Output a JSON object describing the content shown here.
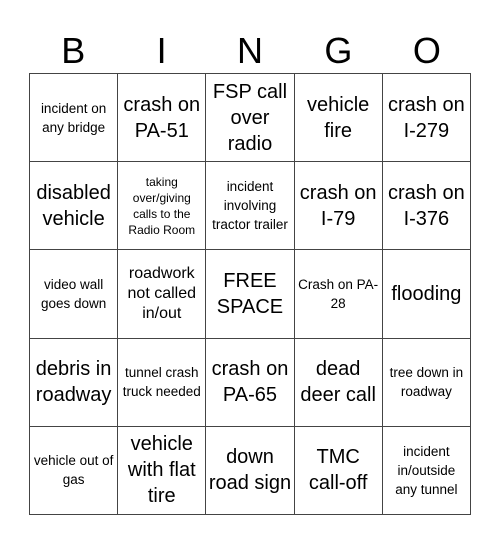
{
  "header": {
    "letters": [
      "B",
      "I",
      "N",
      "G",
      "O"
    ]
  },
  "card": {
    "rows": [
      [
        "incident on any bridge",
        "crash on PA-51",
        "FSP call over radio",
        "vehicle fire",
        "crash on I-279"
      ],
      [
        "disabled vehicle",
        "taking over/giving calls to the Radio Room",
        "incident involving tractor trailer",
        "crash on I-79",
        "crash on I-376"
      ],
      [
        "video wall goes down",
        "roadwork not called in/out",
        "FREE SPACE",
        "Crash on PA-28",
        "flooding"
      ],
      [
        "debris in roadway",
        "tunnel crash truck needed",
        "crash on PA-65",
        "dead deer call",
        "tree down in roadway"
      ],
      [
        "vehicle out of gas",
        "vehicle with flat tire",
        "down road sign",
        "TMC call-off",
        "incident in/outside any tunnel"
      ]
    ]
  }
}
